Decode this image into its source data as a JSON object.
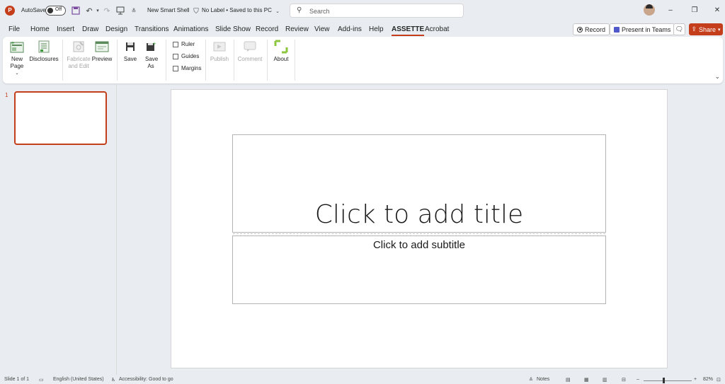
{
  "titlebar": {
    "autosave_label": "AutoSave",
    "autosave_state": "Off",
    "doc_name": "New Smart Shell",
    "label_info": "No Label • Saved to this PC",
    "search_placeholder": "Search"
  },
  "menu": {
    "tabs": [
      "File",
      "Home",
      "Insert",
      "Draw",
      "Design",
      "Transitions",
      "Animations",
      "Slide Show",
      "Record",
      "Review",
      "View",
      "Add-ins",
      "Help",
      "ASSETTE",
      "Acrobat"
    ],
    "active_tab": "ASSETTE",
    "record_label": "Record",
    "present_label": "Present in Teams",
    "share_label": "Share"
  },
  "ribbon": {
    "new_page": "New Page",
    "disclosures": "Disclosures",
    "fabricate": "Fabricate and Edit",
    "preview": "Preview",
    "save": "Save",
    "save_as": "Save As",
    "ruler": "Ruler",
    "guides": "Guides",
    "margins": "Margins",
    "publish": "Publish",
    "comment": "Comment",
    "about": "About"
  },
  "thumbnails": {
    "slide_number": "1"
  },
  "slide": {
    "title_placeholder": "Click to add title",
    "subtitle_placeholder": "Click to add subtitle"
  },
  "statusbar": {
    "slide_info": "Slide 1 of 1",
    "language": "English (United States)",
    "accessibility": "Accessibility: Good to go",
    "notes": "Notes",
    "zoom_minus": "–",
    "zoom_plus": "+",
    "zoom": "82%"
  },
  "colors": {
    "accent": "#c43e1c",
    "background": "#e9edf1"
  }
}
